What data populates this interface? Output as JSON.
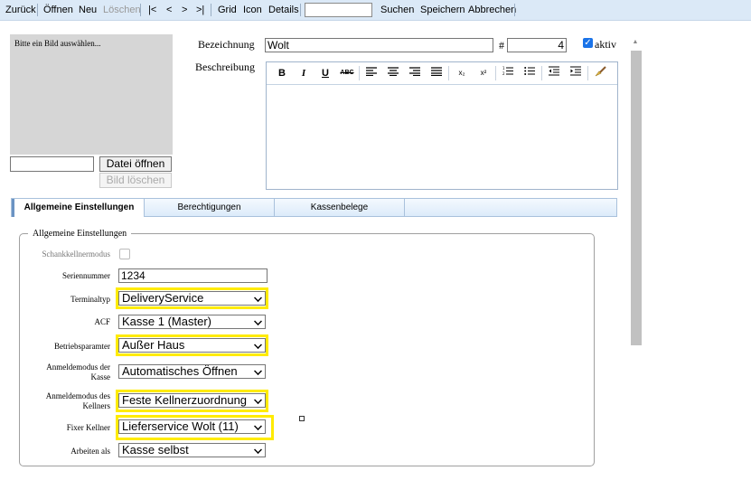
{
  "toolbar": {
    "back": "Zurück",
    "open": "Öffnen",
    "new": "Neu",
    "delete": "Löschen",
    "first": "|<",
    "prev": "<",
    "next": ">",
    "last": ">|",
    "grid": "Grid",
    "icon": "Icon",
    "details": "Details",
    "search_value": "",
    "search": "Suchen",
    "save": "Speichern",
    "cancel": "Abbrechen"
  },
  "image": {
    "placeholder": "Bitte ein Bild auswählen...",
    "file_value": "",
    "open_file": "Datei öffnen",
    "delete_image": "Bild löschen"
  },
  "header": {
    "name_label": "Bezeichnung",
    "name_value": "Wolt",
    "number_label": "#",
    "number_value": "4",
    "active_label": "aktiv",
    "active_checked": true,
    "description_label": "Beschreibung"
  },
  "editor_icons": [
    "bold-icon",
    "italic-icon",
    "underline-icon",
    "strikethrough-icon",
    "align-left-icon",
    "align-center-icon",
    "align-right-icon",
    "justify-icon",
    "subscript-icon",
    "superscript-icon",
    "ordered-list-icon",
    "unordered-list-icon",
    "outdent-icon",
    "indent-icon",
    "clean-icon"
  ],
  "editor_glyphs": {
    "bold": "B",
    "italic": "I",
    "underline": "U",
    "strike": "ABC",
    "sub": "x₂",
    "sup": "x²"
  },
  "tabs": [
    {
      "label": "Allgemeine Einstellungen",
      "active": true
    },
    {
      "label": "Berechtigungen",
      "active": false
    },
    {
      "label": "Kassenbelege",
      "active": false
    }
  ],
  "general": {
    "legend": "Allgemeine Einstellungen",
    "schank_label": "Schankkellnermodus",
    "schank_checked": false,
    "serial_label": "Seriennummer",
    "serial_value": "1234",
    "terminal_label": "Terminaltyp",
    "terminal_value": "DeliveryService",
    "acf_label": "ACF",
    "acf_value": "Kasse 1 (Master)",
    "operation_label": "Betriebsparamter",
    "operation_value": "Außer Haus",
    "login_register_label_1": "Anmeldemodus der",
    "login_register_label_2": "Kasse",
    "login_register_value": "Automatisches Öffnen",
    "login_waiter_label_1": "Anmeldemodus des",
    "login_waiter_label_2": "Kellners",
    "login_waiter_value": "Feste Kellnerzuordnung",
    "fixed_waiter_label": "Fixer Kellner",
    "fixed_waiter_value": "Lieferservice Wolt (11)",
    "work_as_label": "Arbeiten als",
    "work_as_value": "Kasse selbst"
  },
  "colors": {
    "highlight": "#ffeb00",
    "toolbar_bg": "#dbe9f7",
    "checkbox_accent": "#1a73e8"
  }
}
